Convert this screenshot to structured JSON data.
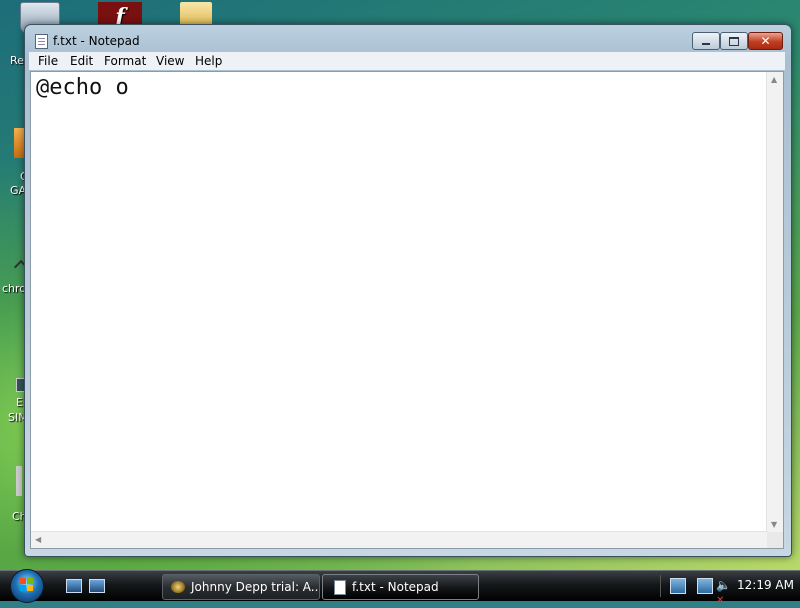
{
  "desktop": {
    "icon_fragments": [
      "Re",
      "G",
      "GA",
      "chro",
      "E",
      "SIM",
      "Ch"
    ]
  },
  "window": {
    "title": "f.txt - Notepad",
    "close_glyph": "✕",
    "menu": {
      "file": "File",
      "edit": "Edit",
      "format": "Format",
      "view": "View",
      "help": "Help"
    },
    "content": "@echo o"
  },
  "taskbar": {
    "tasks": [
      {
        "label": "Johnny Depp trial: A...",
        "icon": "browser-icon"
      },
      {
        "label": "f.txt - Notepad",
        "icon": "notepad-icon",
        "active": true
      }
    ],
    "clock": "12:19 AM",
    "volume_muted_glyph": "✕"
  },
  "colors": {
    "taskbar": "#15181b",
    "close_button": "#c23d22",
    "window_frame": "#a9c0d2"
  }
}
